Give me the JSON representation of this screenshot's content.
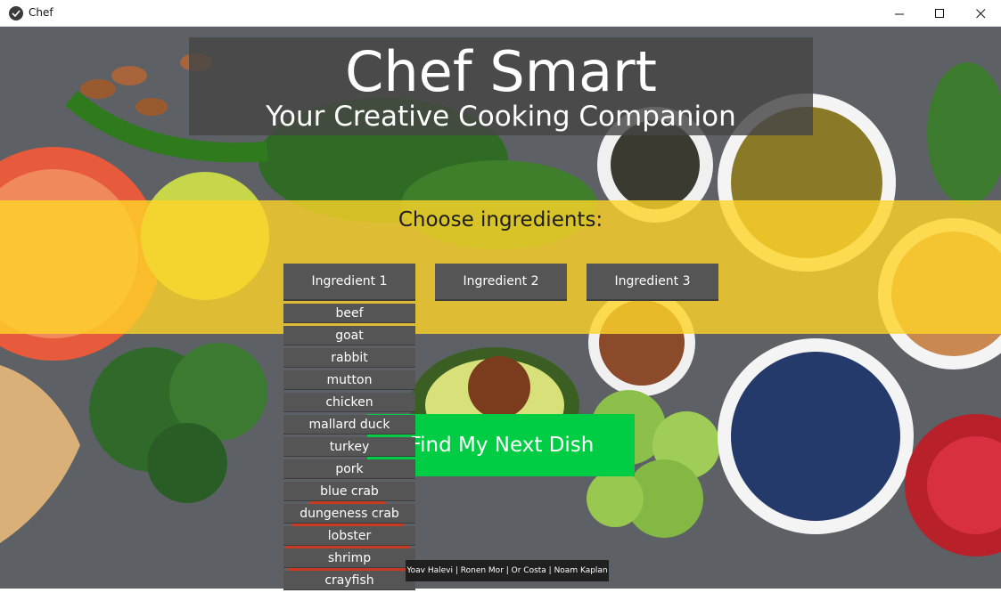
{
  "window": {
    "title": "Chef",
    "controls": {
      "minimize_icon": "minimize-icon",
      "maximize_icon": "maximize-icon",
      "close_icon": "close-icon"
    }
  },
  "header": {
    "title": "Chef Smart",
    "subtitle": "Your Creative Cooking Companion"
  },
  "ingredients": {
    "prompt": "Choose ingredients:",
    "buttons": [
      "Ingredient 1",
      "Ingredient 2",
      "Ingredient 3"
    ],
    "dropdown_options": [
      "beef",
      "goat",
      "rabbit",
      "mutton",
      "chicken",
      "mallard duck",
      "turkey",
      "pork",
      "blue crab",
      "dungeness crab",
      "lobster",
      "shrimp",
      "crayfish"
    ]
  },
  "actions": {
    "find_label": "Find My Next Dish"
  },
  "footer": {
    "credits": "Yoav Halevi | Ronen Mor | Or Costa | Noam Kaplan"
  },
  "colors": {
    "band": "#ffd528",
    "button": "#555555",
    "find_button": "#00cc44",
    "header_panel": "#464646"
  }
}
